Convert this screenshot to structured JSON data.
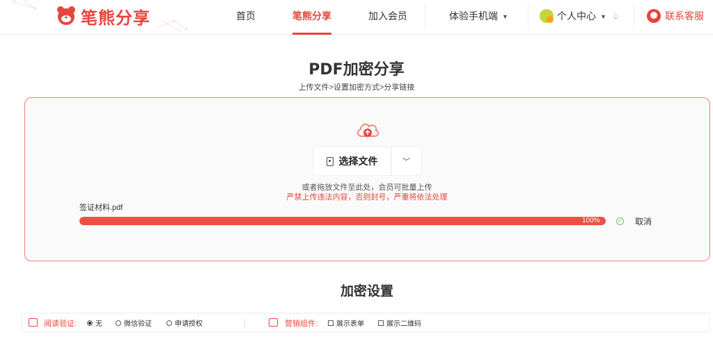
{
  "header": {
    "logo_text": "笔熊分享",
    "nav": [
      {
        "label": "首页"
      },
      {
        "label": "笔熊分享"
      },
      {
        "label": "加入会员"
      },
      {
        "label": "体验手机端"
      }
    ],
    "user_center": "个人中心",
    "service": "联系客服"
  },
  "main": {
    "title": "PDF加密分享",
    "steps": "上传文件>设置加密方式>分享链接",
    "select_button": "选择文件",
    "drop_hint": "或者拖放文件至此处，会员可批量上传",
    "warning": "严禁上传违法内容，否则封号，严重将依法处理",
    "file_name": "签证材料.pdf",
    "progress_percent": 100,
    "progress_label": "100%",
    "cancel": "取消"
  },
  "settings": {
    "title": "加密设置",
    "read_verify_label": "阅读验证:",
    "read_options": [
      "无",
      "微信验证",
      "申请授权"
    ],
    "selected_read_option": "无",
    "marketing_label": "营销组件:",
    "marketing_options": [
      "展示表单",
      "展示二维码"
    ]
  },
  "colors": {
    "accent": "#e8453c",
    "progress": "#ea5145",
    "success": "#6cbf6a"
  },
  "icons": {
    "logo": "bear-logo-icon",
    "upload": "cloud-upload-icon",
    "bell": "bell-icon",
    "service": "customer-service-icon",
    "file": "file-icon",
    "ok": "check-circle-icon"
  }
}
